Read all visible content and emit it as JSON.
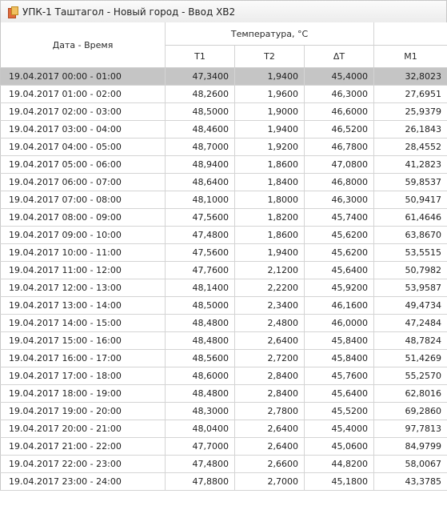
{
  "window": {
    "title": "УПК-1 Таштагол - Новый город - Ввод ХВ2"
  },
  "columns": {
    "date": "Дата - Время",
    "temperature_group": "Температура, °С",
    "t1": "T1",
    "t2": "T2",
    "dt": "ΔT",
    "m1": "M1"
  },
  "rows": [
    {
      "date": "19.04.2017 00:00 - 01:00",
      "t1": "47,3400",
      "t2": "1,9400",
      "dt": "45,4000",
      "m1": "32,8023"
    },
    {
      "date": "19.04.2017 01:00 - 02:00",
      "t1": "48,2600",
      "t2": "1,9600",
      "dt": "46,3000",
      "m1": "27,6951"
    },
    {
      "date": "19.04.2017 02:00 - 03:00",
      "t1": "48,5000",
      "t2": "1,9000",
      "dt": "46,6000",
      "m1": "25,9379"
    },
    {
      "date": "19.04.2017 03:00 - 04:00",
      "t1": "48,4600",
      "t2": "1,9400",
      "dt": "46,5200",
      "m1": "26,1843"
    },
    {
      "date": "19.04.2017 04:00 - 05:00",
      "t1": "48,7000",
      "t2": "1,9200",
      "dt": "46,7800",
      "m1": "28,4552"
    },
    {
      "date": "19.04.2017 05:00 - 06:00",
      "t1": "48,9400",
      "t2": "1,8600",
      "dt": "47,0800",
      "m1": "41,2823"
    },
    {
      "date": "19.04.2017 06:00 - 07:00",
      "t1": "48,6400",
      "t2": "1,8400",
      "dt": "46,8000",
      "m1": "59,8537"
    },
    {
      "date": "19.04.2017 07:00 - 08:00",
      "t1": "48,1000",
      "t2": "1,8000",
      "dt": "46,3000",
      "m1": "50,9417"
    },
    {
      "date": "19.04.2017 08:00 - 09:00",
      "t1": "47,5600",
      "t2": "1,8200",
      "dt": "45,7400",
      "m1": "61,4646"
    },
    {
      "date": "19.04.2017 09:00 - 10:00",
      "t1": "47,4800",
      "t2": "1,8600",
      "dt": "45,6200",
      "m1": "63,8670"
    },
    {
      "date": "19.04.2017 10:00 - 11:00",
      "t1": "47,5600",
      "t2": "1,9400",
      "dt": "45,6200",
      "m1": "53,5515"
    },
    {
      "date": "19.04.2017 11:00 - 12:00",
      "t1": "47,7600",
      "t2": "2,1200",
      "dt": "45,6400",
      "m1": "50,7982"
    },
    {
      "date": "19.04.2017 12:00 - 13:00",
      "t1": "48,1400",
      "t2": "2,2200",
      "dt": "45,9200",
      "m1": "53,9587"
    },
    {
      "date": "19.04.2017 13:00 - 14:00",
      "t1": "48,5000",
      "t2": "2,3400",
      "dt": "46,1600",
      "m1": "49,4734"
    },
    {
      "date": "19.04.2017 14:00 - 15:00",
      "t1": "48,4800",
      "t2": "2,4800",
      "dt": "46,0000",
      "m1": "47,2484"
    },
    {
      "date": "19.04.2017 15:00 - 16:00",
      "t1": "48,4800",
      "t2": "2,6400",
      "dt": "45,8400",
      "m1": "48,7824"
    },
    {
      "date": "19.04.2017 16:00 - 17:00",
      "t1": "48,5600",
      "t2": "2,7200",
      "dt": "45,8400",
      "m1": "51,4269"
    },
    {
      "date": "19.04.2017 17:00 - 18:00",
      "t1": "48,6000",
      "t2": "2,8400",
      "dt": "45,7600",
      "m1": "55,2570"
    },
    {
      "date": "19.04.2017 18:00 - 19:00",
      "t1": "48,4800",
      "t2": "2,8400",
      "dt": "45,6400",
      "m1": "62,8016"
    },
    {
      "date": "19.04.2017 19:00 - 20:00",
      "t1": "48,3000",
      "t2": "2,7800",
      "dt": "45,5200",
      "m1": "69,2860"
    },
    {
      "date": "19.04.2017 20:00 - 21:00",
      "t1": "48,0400",
      "t2": "2,6400",
      "dt": "45,4000",
      "m1": "97,7813"
    },
    {
      "date": "19.04.2017 21:00 - 22:00",
      "t1": "47,7000",
      "t2": "2,6400",
      "dt": "45,0600",
      "m1": "84,9799"
    },
    {
      "date": "19.04.2017 22:00 - 23:00",
      "t1": "47,4800",
      "t2": "2,6600",
      "dt": "44,8200",
      "m1": "58,0067"
    },
    {
      "date": "19.04.2017 23:00 - 24:00",
      "t1": "47,8800",
      "t2": "2,7000",
      "dt": "45,1800",
      "m1": "43,3785"
    }
  ],
  "selected_row": 0,
  "colors": {
    "selected_row_bg": "#c5c5c5",
    "grid_line": "#d4d4d4",
    "title_bar": "#f2f2f2"
  },
  "icons": {
    "title": "report-icon"
  }
}
